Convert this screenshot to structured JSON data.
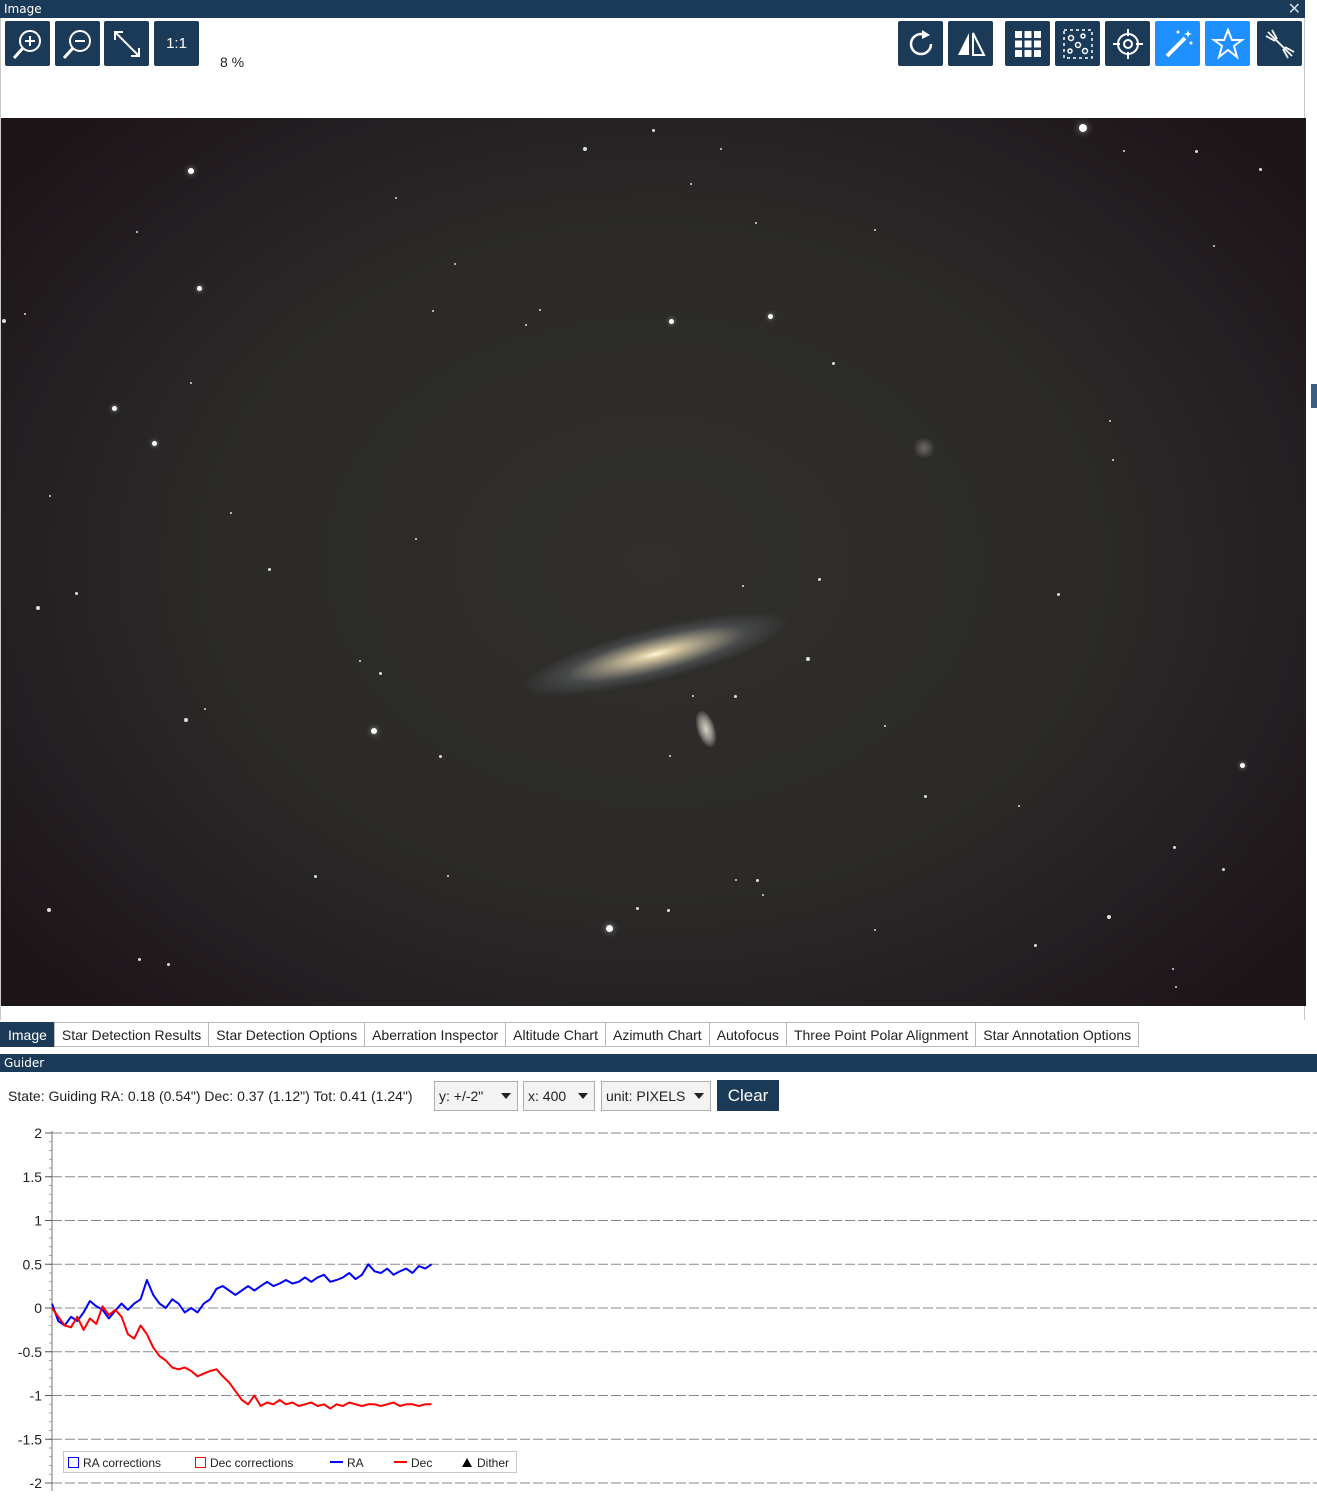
{
  "image_panel": {
    "title": "Image",
    "zoom_label": "8 %",
    "toolbar_left": [
      {
        "name": "zoom-in-icon"
      },
      {
        "name": "zoom-out-icon"
      },
      {
        "name": "fit-to-window-icon"
      },
      {
        "name": "one-to-one",
        "label": "1:1"
      }
    ],
    "toolbar_right": [
      {
        "name": "rotate-icon"
      },
      {
        "name": "flip-icon"
      },
      {
        "name": "grid-icon"
      },
      {
        "name": "star-field-icon"
      },
      {
        "name": "crosshair-icon"
      },
      {
        "name": "magic-wand-icon",
        "active": true
      },
      {
        "name": "star-icon",
        "active": true
      },
      {
        "name": "satellite-icon"
      }
    ]
  },
  "tabs": [
    {
      "label": "Image",
      "active": true
    },
    {
      "label": "Star Detection Results"
    },
    {
      "label": "Star Detection Options"
    },
    {
      "label": "Aberration Inspector"
    },
    {
      "label": "Altitude Chart"
    },
    {
      "label": "Azimuth Chart"
    },
    {
      "label": "Autofocus"
    },
    {
      "label": "Three Point Polar Alignment"
    },
    {
      "label": "Star Annotation Options"
    }
  ],
  "guider": {
    "title": "Guider",
    "state_text": "State: Guiding  RA: 0.18 (0.54\")  Dec: 0.37 (1.12\")  Tot: 0.41 (1.24\")",
    "y_select": "y: +/-2\"",
    "x_select": "x: 400",
    "unit_select": "unit: PIXELS",
    "clear_label": "Clear"
  },
  "colors": {
    "accent_dark": "#1b3a57",
    "accent_active": "#1e90ff",
    "ra_color": "#0000ff",
    "dec_color": "#ff0000"
  },
  "chart_data": {
    "type": "line",
    "ylim": [
      -2,
      2
    ],
    "xlim": [
      0,
      400
    ],
    "y_ticks": [
      "2",
      "1.5",
      "1",
      "0.5",
      "0",
      "-0.5",
      "-1",
      "-1.5",
      "-2"
    ],
    "grid": true,
    "legend": [
      "RA corrections",
      "Dec corrections",
      "RA",
      "Dec",
      "Dither"
    ],
    "legend_position": "bottom-left",
    "series": [
      {
        "name": "RA",
        "color": "#0000ff",
        "x": [
          0,
          2,
          4,
          6,
          8,
          10,
          12,
          14,
          16,
          18,
          20,
          22,
          24,
          26,
          28,
          30,
          32,
          34,
          36,
          38,
          40,
          42,
          44,
          46,
          48,
          50,
          52,
          54,
          56,
          58,
          60,
          62,
          64,
          66,
          68,
          70,
          72,
          74,
          76,
          78,
          80,
          82,
          84,
          86,
          88,
          90,
          92,
          94,
          96,
          98,
          100,
          102,
          104,
          106,
          108,
          110,
          112,
          114,
          116,
          118,
          120
        ],
        "values": [
          0.05,
          -0.15,
          -0.2,
          -0.1,
          -0.15,
          -0.05,
          0.08,
          0.02,
          -0.02,
          -0.12,
          -0.03,
          0.05,
          -0.02,
          0.05,
          0.1,
          0.32,
          0.15,
          0.05,
          0.0,
          0.1,
          0.05,
          -0.05,
          0.0,
          -0.05,
          0.05,
          0.1,
          0.22,
          0.25,
          0.2,
          0.15,
          0.2,
          0.25,
          0.2,
          0.25,
          0.3,
          0.25,
          0.28,
          0.32,
          0.28,
          0.3,
          0.35,
          0.3,
          0.35,
          0.38,
          0.3,
          0.32,
          0.35,
          0.4,
          0.33,
          0.38,
          0.5,
          0.42,
          0.4,
          0.45,
          0.38,
          0.42,
          0.45,
          0.4,
          0.48,
          0.45,
          0.5
        ]
      },
      {
        "name": "Dec",
        "color": "#ff0000",
        "x": [
          0,
          2,
          4,
          6,
          8,
          10,
          12,
          14,
          16,
          18,
          20,
          22,
          24,
          26,
          28,
          30,
          32,
          34,
          36,
          38,
          40,
          42,
          44,
          46,
          48,
          50,
          52,
          54,
          56,
          58,
          60,
          62,
          64,
          66,
          68,
          70,
          72,
          74,
          76,
          78,
          80,
          82,
          84,
          86,
          88,
          90,
          92,
          94,
          96,
          98,
          100,
          102,
          104,
          106,
          108,
          110,
          112,
          114,
          116,
          118,
          120
        ],
        "values": [
          0.0,
          -0.1,
          -0.2,
          -0.22,
          -0.1,
          -0.25,
          -0.12,
          -0.18,
          0.02,
          -0.08,
          -0.02,
          -0.1,
          -0.3,
          -0.35,
          -0.2,
          -0.3,
          -0.45,
          -0.55,
          -0.6,
          -0.68,
          -0.7,
          -0.68,
          -0.72,
          -0.78,
          -0.75,
          -0.72,
          -0.7,
          -0.78,
          -0.85,
          -0.95,
          -1.05,
          -1.1,
          -1.0,
          -1.12,
          -1.08,
          -1.1,
          -1.05,
          -1.1,
          -1.08,
          -1.12,
          -1.1,
          -1.08,
          -1.12,
          -1.1,
          -1.15,
          -1.1,
          -1.12,
          -1.08,
          -1.1,
          -1.12,
          -1.1,
          -1.1,
          -1.12,
          -1.1,
          -1.08,
          -1.12,
          -1.1,
          -1.1,
          -1.12,
          -1.1,
          -1.1
        ]
      }
    ]
  }
}
